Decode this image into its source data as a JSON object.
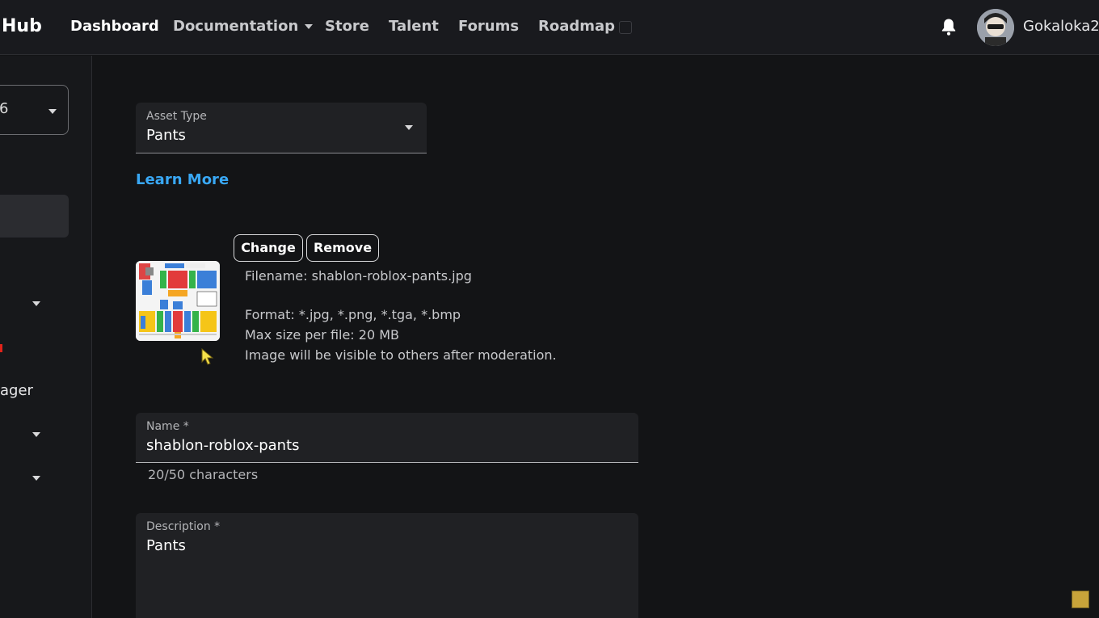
{
  "nav": {
    "brand": "Hub",
    "items": [
      {
        "label": "Dashboard"
      },
      {
        "label": "Documentation"
      },
      {
        "label": "Store"
      },
      {
        "label": "Talent"
      },
      {
        "label": "Forums"
      },
      {
        "label": "Roadmap"
      }
    ],
    "username": "Gokaloka2"
  },
  "sidebar": {
    "selector_text": "6",
    "partial_label": "ager"
  },
  "form": {
    "asset_type": {
      "label": "Asset Type",
      "value": "Pants"
    },
    "learn_more": "Learn More",
    "upload": {
      "change_label": "Change",
      "remove_label": "Remove",
      "filename": "Filename: shablon-roblox-pants.jpg",
      "format": "Format: *.jpg, *.png, *.tga, *.bmp",
      "max_size": "Max size per file: 20 MB",
      "moderation_note": "Image will be visible to others after moderation."
    },
    "name": {
      "label": "Name *",
      "value": "shablon-roblox-pants",
      "counter": "20/50 characters"
    },
    "description": {
      "label": "Description *",
      "value": "Pants"
    }
  },
  "colors": {
    "background": "#131416",
    "link": "#39a8f5",
    "field_bg": "#202124"
  },
  "icons": [
    "bell-icon",
    "avatar",
    "chevron-down-icon",
    "mouse-cursor-icon"
  ]
}
